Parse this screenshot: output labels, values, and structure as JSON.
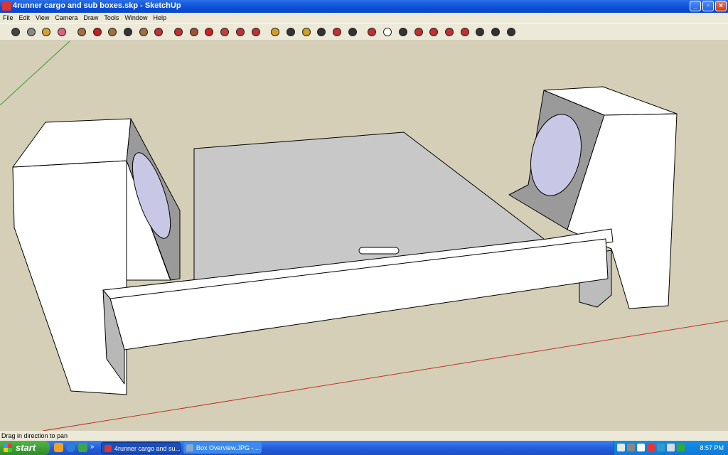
{
  "window": {
    "title": "4runner cargo and sub boxes.skp - SketchUp",
    "min": "0",
    "max": "1",
    "close": "r"
  },
  "menu": [
    "File",
    "Edit",
    "View",
    "Camera",
    "Draw",
    "Tools",
    "Window",
    "Help"
  ],
  "tools": [
    "select-icon",
    "make-component-icon",
    "paint-bucket-icon",
    "eraser-icon",
    "rectangle-icon",
    "line-icon",
    "circle-icon",
    "arc-icon",
    "polygon-icon",
    "freehand-icon",
    "move-icon",
    "push-pull-icon",
    "rotate-icon",
    "follow-me-icon",
    "scale-icon",
    "offset-icon",
    "tape-measure-icon",
    "dimension-icon",
    "protractor-icon",
    "text-icon",
    "axes-icon",
    "3d-text-icon",
    "orbit-icon",
    "pan-icon",
    "zoom-icon",
    "zoom-window-icon",
    "zoom-extents-icon",
    "previous-view-icon",
    "position-camera-icon",
    "look-around-icon",
    "walk-icon",
    "section-plane-icon"
  ],
  "status": {
    "text": "Drag in direction to pan"
  },
  "taskbar": {
    "start": "start",
    "quick_launch_more": "»",
    "tasks": [
      {
        "label": "4runner cargo and su..."
      },
      {
        "label": "Box Overview.JPG - ..."
      }
    ],
    "clock": "8:57 PM"
  }
}
